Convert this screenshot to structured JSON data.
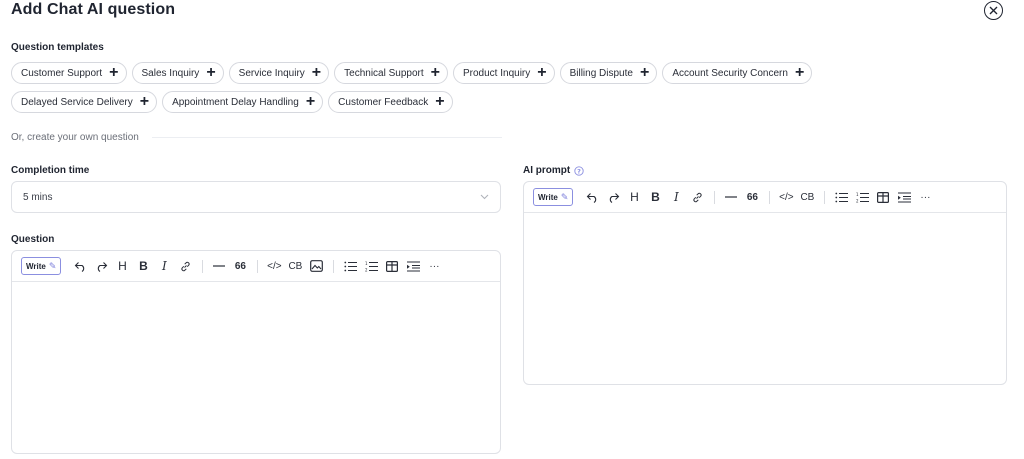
{
  "header": {
    "title": "Add Chat AI question",
    "close_icon": "close-circle-icon"
  },
  "templates": {
    "label": "Question templates",
    "row1": [
      "Customer Support",
      "Sales Inquiry",
      "Service Inquiry",
      "Technical Support",
      "Product Inquiry",
      "Billing Dispute",
      "Account Security Concern"
    ],
    "row2": [
      "Delayed Service Delivery",
      "Appointment Delay Handling",
      "Customer Feedback"
    ]
  },
  "create_own_label": "Or, create your own question",
  "completion": {
    "label": "Completion time",
    "value": "5 mins"
  },
  "question": {
    "label": "Question",
    "toolbar": {
      "write_label": "Write",
      "heading": "H",
      "bold": "B",
      "italic": "I",
      "quote": "66",
      "code": "</>",
      "codeblock": "CB",
      "more": "···"
    }
  },
  "ai_prompt": {
    "label": "AI prompt",
    "toolbar": {
      "write_label": "Write",
      "heading": "H",
      "bold": "B",
      "italic": "I",
      "quote": "66",
      "code": "</>",
      "codeblock": "CB",
      "more": "···"
    }
  },
  "colors": {
    "accent": "#7c7fdb",
    "border": "#dfe1e6",
    "text": "#1f2430"
  }
}
